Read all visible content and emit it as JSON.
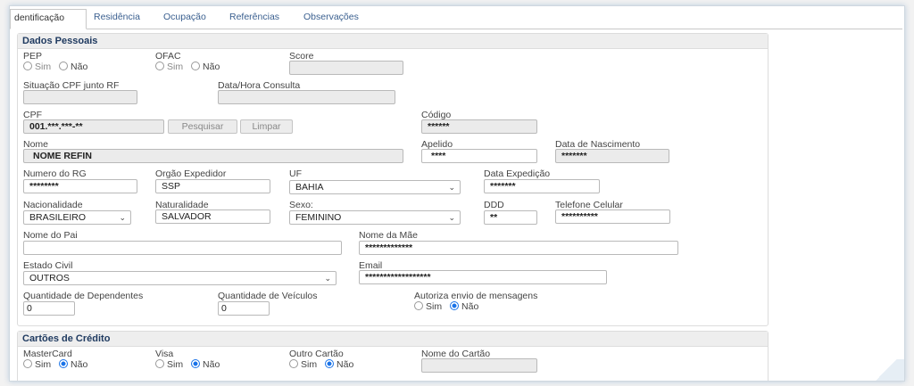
{
  "tabs": [
    "dentificação",
    "Residência",
    "Ocupação",
    "Referências",
    "Observações"
  ],
  "dados": {
    "title": "Dados Pessoais",
    "pep": {
      "label": "PEP",
      "sim": "Sim",
      "nao": "Não"
    },
    "ofac": {
      "label": "OFAC",
      "sim": "Sim",
      "nao": "Não"
    },
    "score": {
      "label": "Score",
      "value": ""
    },
    "situacao": {
      "label": "Situação CPF junto RF",
      "value": ""
    },
    "dataHora": {
      "label": "Data/Hora Consulta",
      "value": ""
    },
    "cpf": {
      "label": "CPF",
      "value": "001.***.***-**",
      "pesquisar": "Pesquisar",
      "limpar": "Limpar"
    },
    "codigo": {
      "label": "Código",
      "value": "******"
    },
    "nome": {
      "label": "Nome",
      "value": "NOME REFIN"
    },
    "apelido": {
      "label": "Apelido",
      "value": "****"
    },
    "nascimento": {
      "label": "Data de Nascimento",
      "value": "*******"
    },
    "rg": {
      "label": "Numero do RG",
      "value": "********"
    },
    "orgao": {
      "label": "Orgão Expedidor",
      "value": "SSP"
    },
    "uf": {
      "label": "UF",
      "value": "BAHIA"
    },
    "expedicao": {
      "label": "Data Expedição",
      "value": "*******"
    },
    "nacionalidade": {
      "label": "Nacionalidade",
      "value": "BRASILEIRO"
    },
    "naturalidade": {
      "label": "Naturalidade",
      "value": "SALVADOR"
    },
    "sexo": {
      "label": "Sexo:",
      "value": "FEMININO"
    },
    "ddd": {
      "label": "DDD",
      "value": "**"
    },
    "celular": {
      "label": "Telefone Celular",
      "value": "**********"
    },
    "pai": {
      "label": "Nome do Pai",
      "value": ""
    },
    "mae": {
      "label": "Nome da Mãe",
      "value": "*************"
    },
    "estadoCivil": {
      "label": "Estado Civil",
      "value": "OUTROS"
    },
    "email": {
      "label": "Email",
      "value": "******************"
    },
    "dependentes": {
      "label": "Quantidade de Dependentes",
      "value": "0"
    },
    "veiculos": {
      "label": "Quantidade de Veículos",
      "value": "0"
    },
    "mensagens": {
      "label": "Autoriza envio de mensagens",
      "sim": "Sim",
      "nao": "Não",
      "selected": "Não"
    }
  },
  "cartoes": {
    "title": "Cartões de Crédito",
    "master": {
      "label": "MasterCard",
      "sim": "Sim",
      "nao": "Não",
      "selected": "Não"
    },
    "visa": {
      "label": "Visa",
      "sim": "Sim",
      "nao": "Não",
      "selected": "Não"
    },
    "outro": {
      "label": "Outro Cartão",
      "sim": "Sim",
      "nao": "Não",
      "selected": "Não"
    },
    "nomeCartao": {
      "label": "Nome do Cartão",
      "value": ""
    }
  }
}
